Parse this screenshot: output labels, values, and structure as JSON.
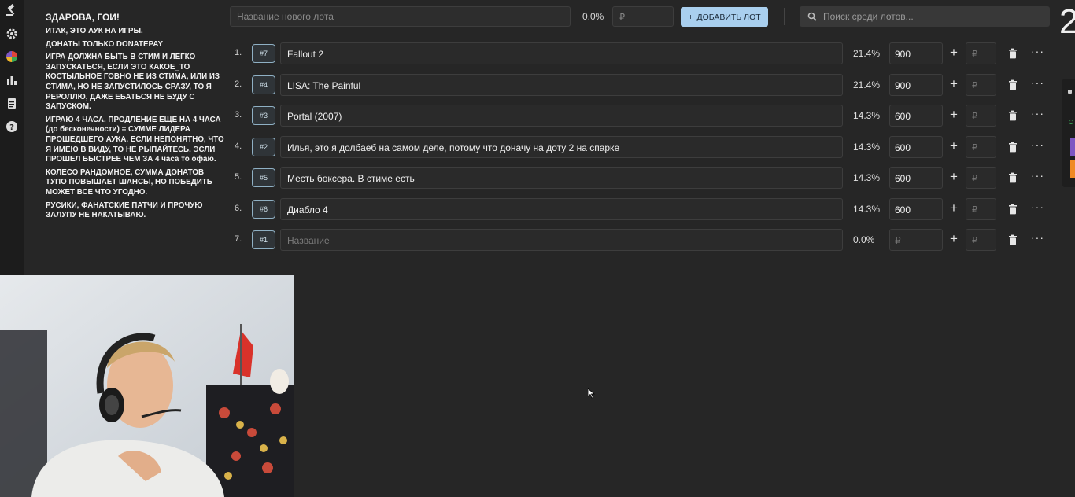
{
  "sidebar": {
    "icons": [
      "gavel-icon",
      "gear-icon",
      "wheel-icon",
      "bar-chart-icon",
      "clipboard-icon",
      "help-icon"
    ]
  },
  "rules": {
    "title": "ЗДАРОВА, ГОИ!",
    "paragraphs": [
      "ИТАК, ЭТО АУК НА ИГРЫ.",
      "ДОНАТЫ ТОЛЬКО DONATEPAY",
      "ИГРА ДОЛЖНА БЫТЬ В СТИМ И ЛЕГКО ЗАПУСКАТЬСЯ, ЕСЛИ ЭТО КАКОЕ_ТО КОСТЫЛЬНОЕ ГОВНО НЕ ИЗ СТИМА, ИЛИ ИЗ СТИМА, НО НЕ ЗАПУСТИЛОСЬ СРАЗУ, ТО Я РЕРОЛЛЮ, ДАЖЕ ЕБАТЬСЯ НЕ БУДУ С ЗАПУСКОМ.",
      "ИГРАЮ 4 ЧАСА, ПРОДЛЕНИЕ ЕЩЕ НА 4 ЧАСА (до бесконечности) = СУММЕ ЛИДЕРА ПРОШЕДШЕГО АУКА. ЕСЛИ НЕПОНЯТНО, ЧТО Я ИМЕЮ В ВИДУ, ТО НЕ РЫПАЙТЕСЬ. ЭСЛИ ПРОШЕЛ БЫСТРЕЕ ЧЕМ ЗА 4 часа то офаю.",
      "КОЛЕСО РАНДОМНОЕ, СУММА ДОНАТОВ ТУПО ПОВЫШАЕТ ШАНСЫ, НО ПОБЕДИТЬ МОЖЕТ ВСЕ ЧТО УГОДНО.",
      "РУСИКИ, ФАНАТСКИЕ ПАТЧИ И ПРОЧУЮ ЗАЛУПУ НЕ НАКАТЫВАЮ."
    ]
  },
  "toolbar": {
    "new_lot_placeholder": "Название нового лота",
    "new_lot_pct": "0.0%",
    "amount_placeholder": "₽",
    "add_button_label": "ДОБАВИТЬ ЛОТ",
    "search_placeholder": "Поиск среди лотов...",
    "big_counter": "2"
  },
  "lots": [
    {
      "idx": "1.",
      "tag": "#7",
      "name": "Fallout 2",
      "pct": "21.4%",
      "amount": "900"
    },
    {
      "idx": "2.",
      "tag": "#4",
      "name": "LISA: The Painful",
      "pct": "21.4%",
      "amount": "900"
    },
    {
      "idx": "3.",
      "tag": "#3",
      "name": "Portal (2007)",
      "pct": "14.3%",
      "amount": "600"
    },
    {
      "idx": "4.",
      "tag": "#2",
      "name": "Илья, это я долбаеб на самом деле, потому что доначу на доту 2 на спарке",
      "pct": "14.3%",
      "amount": "600"
    },
    {
      "idx": "5.",
      "tag": "#5",
      "name": "Месть боксера. В стиме есть",
      "pct": "14.3%",
      "amount": "600"
    },
    {
      "idx": "6.",
      "tag": "#6",
      "name": "Диабло 4",
      "pct": "14.3%",
      "amount": "600"
    },
    {
      "idx": "7.",
      "tag": "#1",
      "name": "",
      "name_placeholder": "Название",
      "pct": "0.0%",
      "amount": "",
      "amount_placeholder": "₽"
    }
  ],
  "row_add_placeholder": "₽",
  "plus_symbol": "+",
  "more_symbol": "···",
  "colors": {
    "accent": "#a9cfee",
    "background": "#262626",
    "tag_border": "#8fb0c4"
  }
}
